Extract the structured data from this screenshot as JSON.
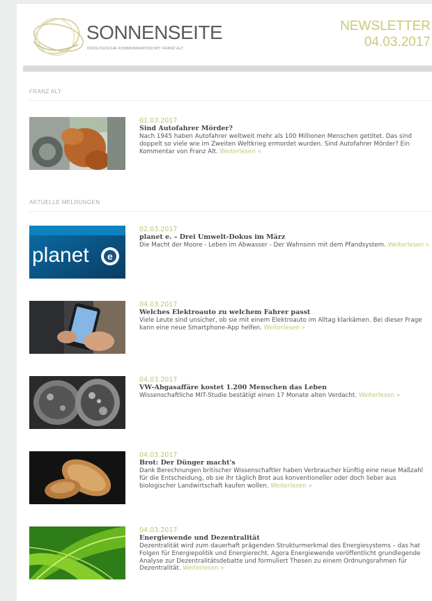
{
  "header": {
    "brand": "SONNENSEITE",
    "tagline": "ÖKOLOGISCHE KOMMUNIKATION MIT FRANZ ALT",
    "newsletter_label": "NEWSLETTER",
    "newsletter_date": "04.03.2017"
  },
  "sections": {
    "franz_alt": "FRANZ ALT",
    "aktuelle": "AKTUELLE MELDUNGEN"
  },
  "read_more": "Weiterlesen »",
  "articles": [
    {
      "date": "01.03.2017",
      "title": "Sind Autofahrer Mörder?",
      "body": "Nach 1945 haben Autofahrer weltweit mehr als 100 Millionen Menschen getötet. Das sind doppelt so viele wie im Zweiten Weltkrieg ermordet wurden. Sind Autofahrer Mörder? Ein Kommentar von Franz Alt."
    },
    {
      "date": "02.03.2017",
      "title": "planet e. – Drei Umwelt-Dokus im März",
      "body": "Die Macht der Moore - Leben im Abwasser - Der Wahnsinn mit dem Pfandsystem.",
      "thumb_text": "planet",
      "thumb_badge": "e"
    },
    {
      "date": "04.03.2017",
      "title": "Welches Elektroauto zu welchem Fahrer passt",
      "body": "Viele Leute sind unsicher, ob sie mit einem Elektroauto im Alltag klarkämen. Bei dieser Frage kann eine neue Smartphone-App helfen."
    },
    {
      "date": "04.03.2017",
      "title": "VW-Abgasaffäre kostet 1.200 Menschen das Leben",
      "body": "Wissenschaftliche MIT-Studie bestätigt einen 17 Monate alten Verdacht."
    },
    {
      "date": "04.03.2017",
      "title": "Brot: Der Dünger macht's",
      "body": "Dank Berechnungen britischer Wissenschaftler haben Verbraucher künftig eine neue Maßzahl für die Entscheidung, ob sie ihr täglich Brot aus konventioneller oder doch lieber aus biologischer Landwirtschaft kaufen wollen."
    },
    {
      "date": "04.03.2017",
      "title": "Energiewende und Dezentralität",
      "body": "Dezentralität wird zum dauerhaft prägenden Strukturmerkmal des Energiesystems – das hat Folgen für Energiepolitik und Energierecht. Agora Energiewende veröffentlicht grundlegende Analyse zur Dezentralitätsdebatte und formuliert Thesen zu einem Ordnungsrahmen für Dezentralität."
    }
  ],
  "colors": {
    "accent": "#c9c97a",
    "page_background": "#eceeed",
    "header_bar": "#d9dcdb"
  }
}
